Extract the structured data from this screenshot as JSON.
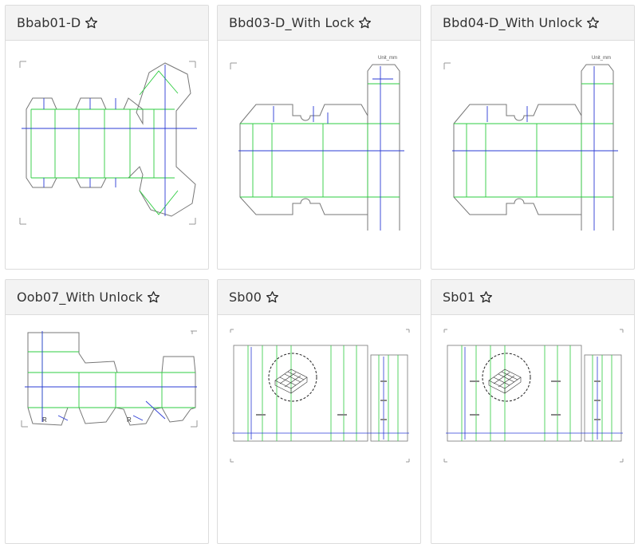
{
  "cards": [
    {
      "title": "Bbab01-D"
    },
    {
      "title": "Bbd03-D_With Lock",
      "unit": "Unit_mm"
    },
    {
      "title": "Bbd04-D_With Unlock",
      "unit": "Unit_mm"
    },
    {
      "title": "Oob07_With Unlock",
      "r_label": "R"
    },
    {
      "title": "Sb00"
    },
    {
      "title": "Sb01"
    }
  ],
  "colors": {
    "fold_line": "#2ecc40",
    "dim_line": "#2b3bd6",
    "cut_line": "#777777"
  },
  "icons": {
    "favorite": "star-outline-icon"
  }
}
